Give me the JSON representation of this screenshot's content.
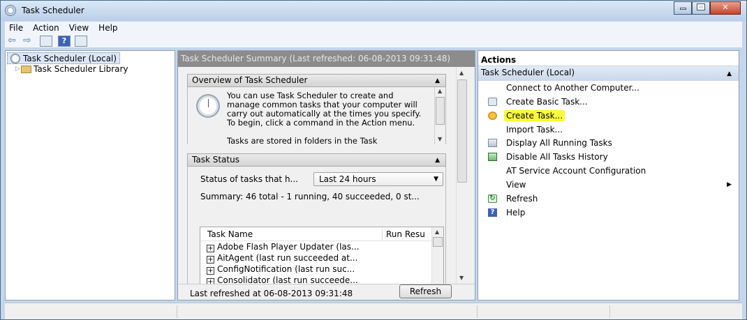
{
  "window": {
    "title": "Task Scheduler"
  },
  "menu": [
    "File",
    "Action",
    "View",
    "Help"
  ],
  "tree": {
    "root": "Task Scheduler (Local)",
    "child": "Task Scheduler Library"
  },
  "middle": {
    "header": "Task Scheduler Summary (Last refreshed: 06-08-2013 09:31:48)",
    "overview": {
      "title": "Overview of Task Scheduler",
      "paragraph1": "You can use Task Scheduler to create and manage common tasks that your computer will carry out automatically at the times you specify. To begin, click a command in the Action menu.",
      "paragraph2": "Tasks are stored in folders in the Task"
    },
    "status": {
      "title": "Task Status",
      "filter_label": "Status of tasks that h...",
      "filter_value": "Last 24 hours",
      "summary": "Summary: 46 total - 1 running, 40 succeeded, 0 st...",
      "columns": [
        "Task Name",
        "Run Resu"
      ],
      "rows": [
        "Adobe Flash Player Updater (las...",
        "AitAgent (last run succeeded at...",
        "ConfigNotification (last run suc...",
        "Consolidator (last run succeede..."
      ]
    },
    "footer": {
      "last_refreshed": "Last refreshed at 06-08-2013 09:31:48",
      "refresh_button": "Refresh"
    }
  },
  "actions": {
    "header": "Actions",
    "group": "Task Scheduler (Local)",
    "items": [
      {
        "label": "Connect to Another Computer...",
        "icon": "none"
      },
      {
        "label": "Create Basic Task...",
        "icon": "wizard-icon"
      },
      {
        "label": "Create Task...",
        "icon": "task-icon",
        "highlighted": true
      },
      {
        "label": "Import Task...",
        "icon": "none"
      },
      {
        "label": "Display All Running Tasks",
        "icon": "running-tasks-icon"
      },
      {
        "label": "Disable All Tasks History",
        "icon": "history-icon"
      },
      {
        "label": "AT Service Account Configuration",
        "icon": "none"
      },
      {
        "label": "View",
        "icon": "none",
        "submenu": true
      },
      {
        "label": "Refresh",
        "icon": "refresh-icon"
      },
      {
        "label": "Help",
        "icon": "help-icon"
      }
    ]
  },
  "colors": {
    "highlight": "#fdfd3e",
    "summary_header_bg": "#8c8c8c",
    "actions_group_bg": "#c9d8ea"
  }
}
